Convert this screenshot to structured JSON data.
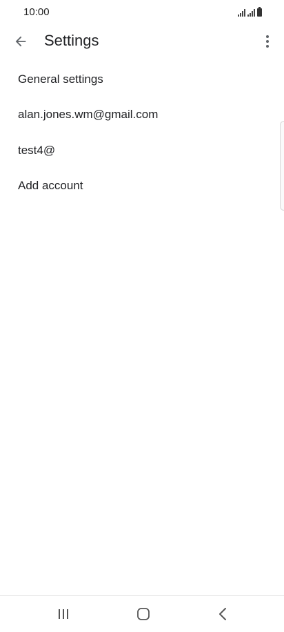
{
  "status_bar": {
    "time": "10:00"
  },
  "app_bar": {
    "title": "Settings",
    "back_icon": "arrow-back-icon",
    "overflow_icon": "more-vert-icon"
  },
  "settings": {
    "items": [
      {
        "label": "General settings"
      },
      {
        "label": "alan.jones.wm@gmail.com"
      },
      {
        "label": "test4@"
      },
      {
        "label": "Add account"
      }
    ]
  },
  "navigation": {
    "recents_icon": "recents-icon",
    "home_icon": "home-icon",
    "back_icon": "back-icon"
  },
  "colors": {
    "text": "#202124",
    "icon": "#5f6368",
    "background": "#ffffff"
  }
}
